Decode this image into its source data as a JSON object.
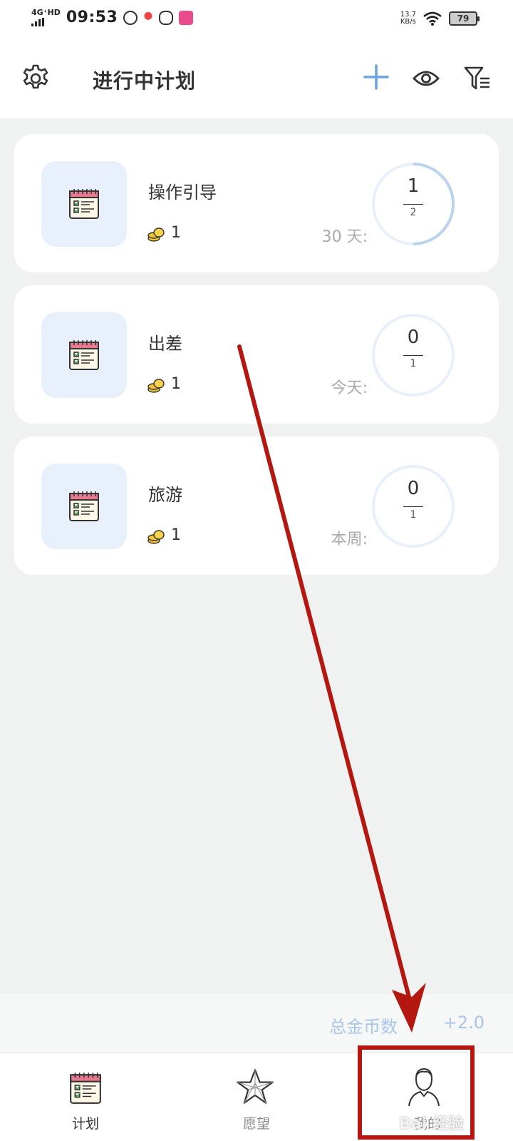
{
  "status_bar": {
    "network": "4G⁺HD",
    "time": "09:53",
    "speed_value": "13.7",
    "speed_unit": "KB/s",
    "battery": "79"
  },
  "header": {
    "title": "进行中计划",
    "icons": {
      "settings": "gear-icon",
      "add": "plus-icon",
      "view": "eye-icon",
      "filter": "filter-icon"
    },
    "accent": "#6aa3e0"
  },
  "plans": [
    {
      "name": "操作引导",
      "coins": "1",
      "period": "30 天:",
      "done": "1",
      "total": "2",
      "progress": 0.5
    },
    {
      "name": "出差",
      "coins": "1",
      "period": "今天:",
      "done": "0",
      "total": "1",
      "progress": 0
    },
    {
      "name": "旅游",
      "coins": "1",
      "period": "本周:",
      "done": "0",
      "total": "1",
      "progress": 0
    }
  ],
  "totals": {
    "label": "总金币数",
    "value": "+2.0",
    "color": "#a9c5e8"
  },
  "tabs": [
    {
      "label": "计划",
      "icon": "calendar-icon"
    },
    {
      "label": "愿望",
      "icon": "star-icon"
    },
    {
      "label": "我的",
      "icon": "user-icon"
    }
  ],
  "annotation": {
    "color": "#b3170f"
  },
  "watermark": "Bai 经验"
}
